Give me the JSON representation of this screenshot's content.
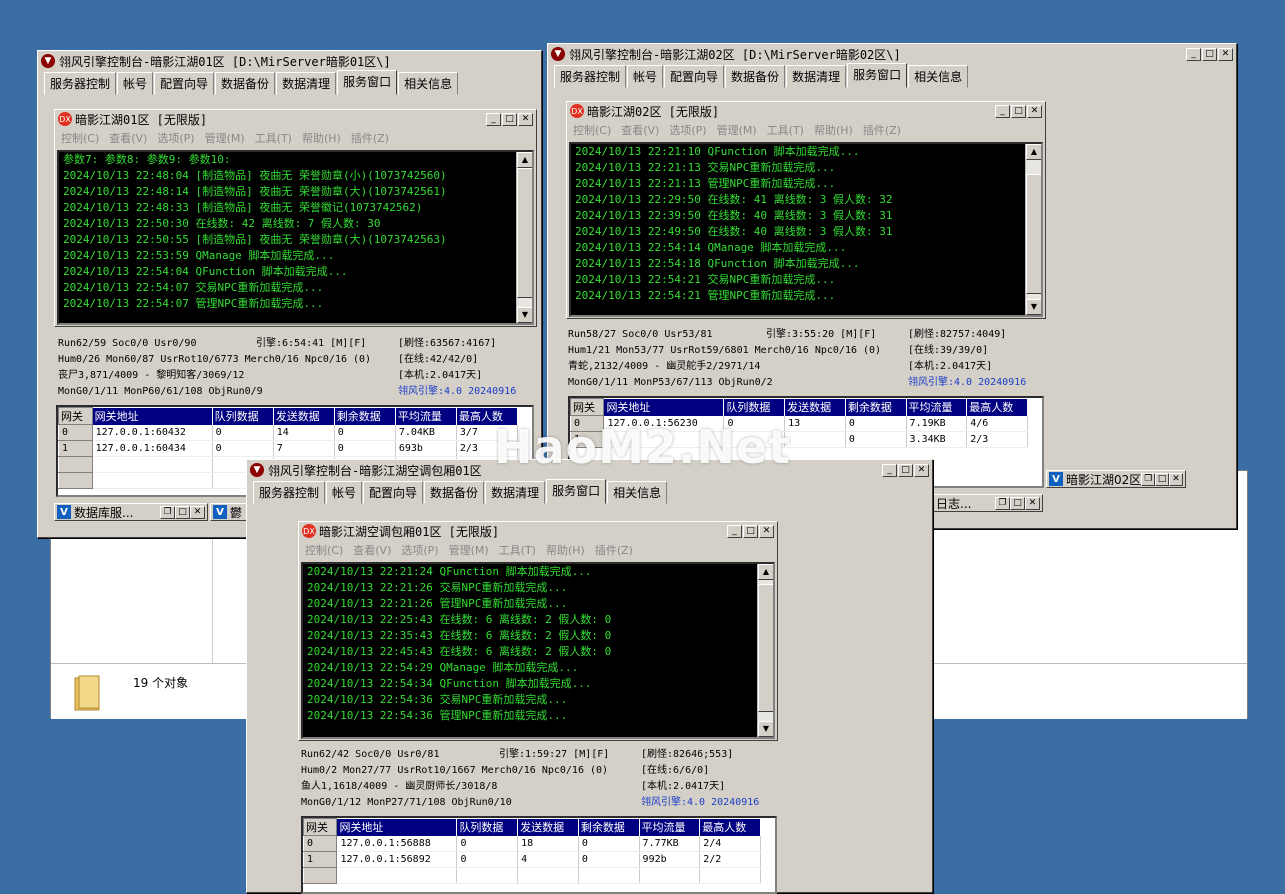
{
  "explorer": {
    "object_count": "19 个对象"
  },
  "tabs": [
    "服务器控制",
    "帐号",
    "配置向导",
    "数据备份",
    "数据清理",
    "服务窗口",
    "相关信息"
  ],
  "menu": [
    "控制(C)",
    "查看(V)",
    "选项(P)",
    "管理(M)",
    "工具(T)",
    "帮助(H)",
    "插件(Z)"
  ],
  "grid_headers": [
    "网关",
    "网关地址",
    "队列数据",
    "发送数据",
    "剩余数据",
    "平均流量",
    "最高人数"
  ],
  "win1": {
    "title": "翎风引擎控制台-暗影江湖01区 [D:\\MirServer暗影01区\\]",
    "inner_title": "暗影江湖01区 [无限版]",
    "console": [
      "参数7: 参数8: 参数9: 参数10:",
      "2024/10/13 22:48:04 [制造物品] 夜曲无 荣誉勋章(小)(1073742560)",
      "2024/10/13 22:48:14 [制造物品] 夜曲无 荣誉勋章(大)(1073742561)",
      "2024/10/13 22:48:33 [制造物品] 夜曲无 荣誉徽记(1073742562)",
      "2024/10/13 22:50:30 在线数: 42 离线数: 7 假人数: 30",
      "2024/10/13 22:50:55 [制造物品] 夜曲无 荣誉勋章(大)(1073742563)",
      "2024/10/13 22:53:59 QManage 脚本加载完成...",
      "2024/10/13 22:54:04 QFunction 脚本加载完成...",
      "2024/10/13 22:54:07 交易NPC重新加载完成...",
      "2024/10/13 22:54:07 管理NPC重新加载完成..."
    ],
    "stats": {
      "r1a": "Run62/59 Soc0/0 Usr0/90",
      "r1b": "引擎:6:54:41 [M][F]",
      "r1c": "[刷怪:63567:4167]",
      "r2a": "Hum0/26 Mon60/87 UsrRot10/6773 Merch0/16 Npc0/16 (0)",
      "r2c": "[在线:42/42/0]",
      "r3a": "丧尸3,871/4009 - 黎明知客/3069/12",
      "r3c": "[本机:2.0417天]",
      "r4a": "MonG0/1/11 MonP60/61/108 ObjRun0/9",
      "r4c": "翎风引擎:4.0 20240916"
    },
    "rows": [
      [
        "0",
        "127.0.0.1:60432",
        "0",
        "14",
        "0",
        "7.04KB",
        "3/7"
      ],
      [
        "1",
        "127.0.0.1:60434",
        "0",
        "7",
        "0",
        "693b",
        "2/3"
      ]
    ],
    "min1": "数据库服...",
    "min2": "鬱"
  },
  "win2": {
    "title": "翎风引擎控制台-暗影江湖02区 [D:\\MirServer暗影02区\\]",
    "inner_title": "暗影江湖02区 [无限版]",
    "console": [
      "2024/10/13 22:21:10 QFunction 脚本加载完成...",
      "2024/10/13 22:21:13 交易NPC重新加载完成...",
      "2024/10/13 22:21:13 管理NPC重新加载完成...",
      "2024/10/13 22:29:50 在线数: 41 离线数: 3 假人数: 32",
      "2024/10/13 22:39:50 在线数: 40 离线数: 3 假人数: 31",
      "2024/10/13 22:49:50 在线数: 40 离线数: 3 假人数: 31",
      "2024/10/13 22:54:14 QManage 脚本加载完成...",
      "2024/10/13 22:54:18 QFunction 脚本加载完成...",
      "2024/10/13 22:54:21 交易NPC重新加载完成...",
      "2024/10/13 22:54:21 管理NPC重新加载完成..."
    ],
    "stats": {
      "r1a": "Run58/27 Soc0/0 Usr53/81",
      "r1b": "引擎:3:55:20 [M][F]",
      "r1c": "[刷怪:82757:4049]",
      "r2a": "Hum1/21 Mon53/77 UsrRot59/6801 Merch0/16 Npc0/16 (0)",
      "r2c": "[在线:39/39/0]",
      "r3a": "青蛇,2132/4009 - 幽灵舵手2/2971/14",
      "r3c": "[本机:2.0417天]",
      "r4a": "MonG0/1/11 MonP53/67/113 ObjRun0/2",
      "r4c": "翎风引擎:4.0 20240916"
    },
    "rows": [
      [
        "0",
        "127.0.0.1:56230",
        "0",
        "13",
        "0",
        "7.19KB",
        "4/6"
      ],
      [
        "1",
        "",
        "",
        "",
        "0",
        "3.34KB",
        "2/3"
      ]
    ],
    "min1": "暗影江湖02区",
    "min2": "日志..."
  },
  "win3": {
    "title": "翎风引擎控制台-暗影江湖空调包厢01区",
    "inner_title": "暗影江湖空调包厢01区 [无限版]",
    "console": [
      "2024/10/13 22:21:24 QFunction 脚本加载完成...",
      "2024/10/13 22:21:26 交易NPC重新加载完成...",
      "2024/10/13 22:21:26 管理NPC重新加载完成...",
      "2024/10/13 22:25:43 在线数: 6 离线数: 2 假人数: 0",
      "2024/10/13 22:35:43 在线数: 6 离线数: 2 假人数: 0",
      "2024/10/13 22:45:43 在线数: 6 离线数: 2 假人数: 0",
      "2024/10/13 22:54:29 QManage 脚本加载完成...",
      "2024/10/13 22:54:34 QFunction 脚本加载完成...",
      "2024/10/13 22:54:36 交易NPC重新加载完成...",
      "2024/10/13 22:54:36 管理NPC重新加载完成..."
    ],
    "stats": {
      "r1a": "Run62/42 Soc0/0 Usr0/81",
      "r1b": "引擎:1:59:27 [M][F]",
      "r1c": "[刷怪:82646;553]",
      "r2a": "Hum0/2 Mon27/77 UsrRot10/1667 Merch0/16 Npc0/16 (0)",
      "r2c": "[在线:6/6/0]",
      "r3a": "鱼人1,1618/4009 - 幽灵厨师长/3018/8",
      "r3c": "[本机:2.0417天]",
      "r4a": "MonG0/1/12 MonP27/71/108 ObjRun0/10",
      "r4c": "翎风引擎:4.0 20240916"
    },
    "rows": [
      [
        "0",
        "127.0.0.1:56888",
        "0",
        "18",
        "0",
        "7.77KB",
        "2/4"
      ],
      [
        "1",
        "127.0.0.1:56892",
        "0",
        "4",
        "0",
        "992b",
        "2/2"
      ]
    ]
  },
  "watermark": "HaoM2.Net"
}
